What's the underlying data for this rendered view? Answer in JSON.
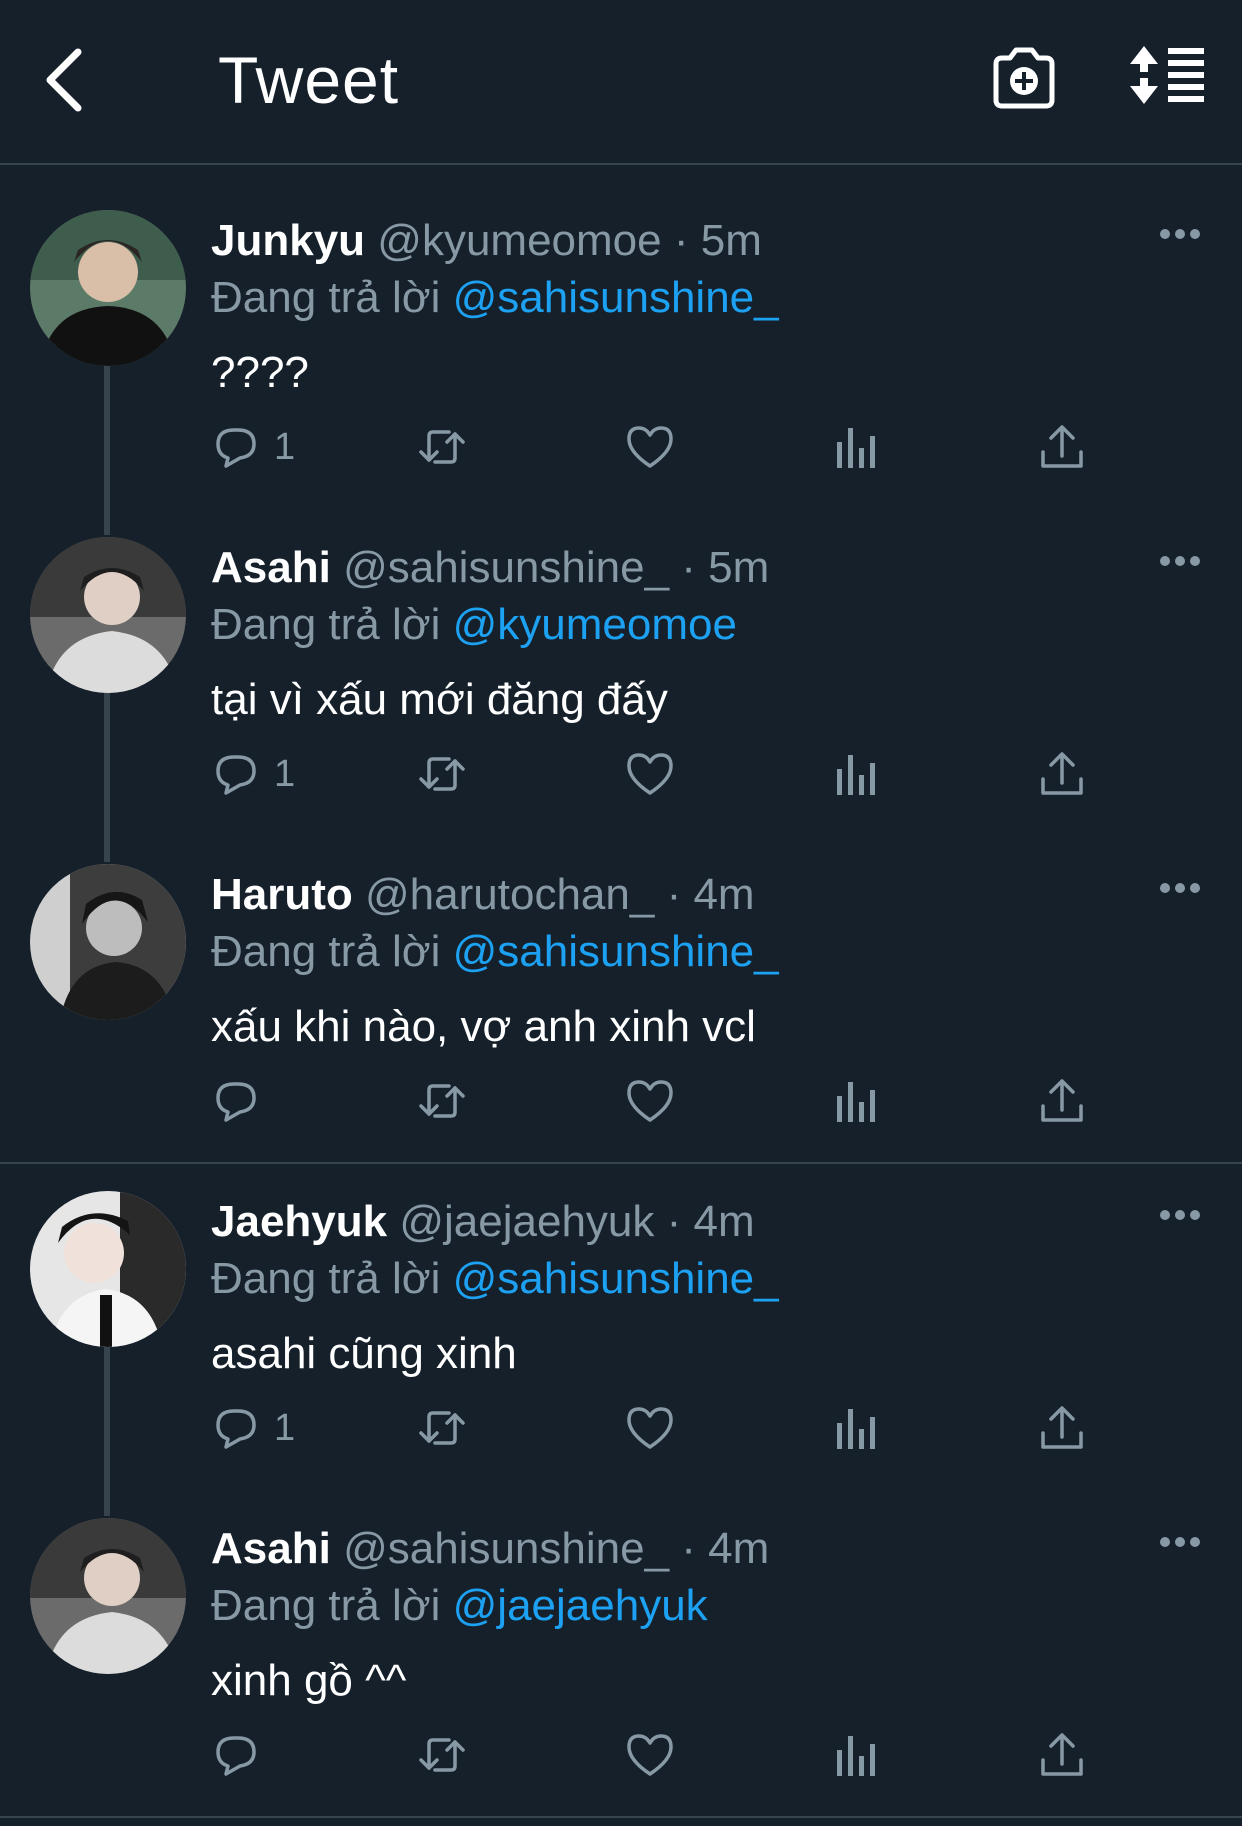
{
  "header": {
    "title": "Tweet",
    "back_icon": "chevron-left-icon",
    "camera_icon": "camera-add-icon",
    "sort_icon": "sort-icon"
  },
  "colors": {
    "background": "#15202b",
    "divider": "#38444d",
    "muted": "#8899a6",
    "accent": "#1da1f2"
  },
  "tweets": [
    {
      "name": "Junkyu",
      "handle": "@kyumeomoe",
      "dot": "·",
      "time": "5m",
      "reply_prefix": "Đang trả lời",
      "reply_to": "@sahisunshine_",
      "text": "????",
      "reply_count": "1",
      "avatar_icon": "avatar-photo"
    },
    {
      "name": "Asahi",
      "handle": "@sahisunshine_",
      "dot": "·",
      "time": "5m",
      "reply_prefix": "Đang trả lời",
      "reply_to": "@kyumeomoe",
      "text": "tại vì xấu mới đăng đấy",
      "reply_count": "1",
      "avatar_icon": "avatar-photo"
    },
    {
      "name": "Haruto",
      "handle": "@harutochan_",
      "dot": "·",
      "time": "4m",
      "reply_prefix": "Đang trả lời",
      "reply_to": "@sahisunshine_",
      "text": "xấu khi nào, vợ anh xinh vcl",
      "reply_count": "",
      "avatar_icon": "avatar-photo"
    },
    {
      "name": "Jaehyuk",
      "handle": "@jaejaehyuk",
      "dot": "·",
      "time": "4m",
      "reply_prefix": "Đang trả lời",
      "reply_to": "@sahisunshine_",
      "text": "asahi cũng xinh",
      "reply_count": "1",
      "avatar_icon": "avatar-photo"
    },
    {
      "name": "Asahi",
      "handle": "@sahisunshine_",
      "dot": "·",
      "time": "4m",
      "reply_prefix": "Đang trả lời",
      "reply_to": "@jaejaehyuk",
      "text": "xinh gồ ^^",
      "reply_count": "",
      "avatar_icon": "avatar-photo"
    }
  ],
  "action_icons": [
    "reply-icon",
    "retweet-icon",
    "like-icon",
    "analytics-icon",
    "share-icon"
  ]
}
